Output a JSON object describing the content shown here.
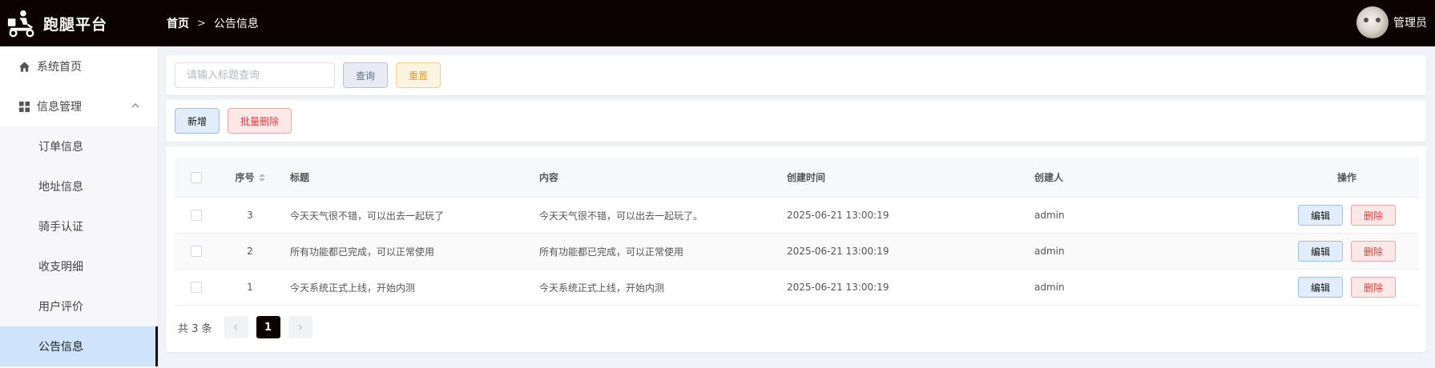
{
  "header": {
    "app_name": "跑腿平台",
    "breadcrumb": {
      "home": "首页",
      "separator": ">",
      "current": "公告信息"
    },
    "user": {
      "name": "管理员",
      "avatar": "cat-avatar"
    },
    "background": "#0c0204"
  },
  "sidebar": {
    "items": [
      {
        "label": "系统首页",
        "icon": "home-icon"
      },
      {
        "label": "信息管理",
        "icon": "grid-icon",
        "expanded": true
      }
    ],
    "submenu": [
      {
        "label": "订单信息"
      },
      {
        "label": "地址信息"
      },
      {
        "label": "骑手认证"
      },
      {
        "label": "收支明细"
      },
      {
        "label": "用户评价"
      },
      {
        "label": "公告信息",
        "active": true
      }
    ],
    "active_color": "#cfe4fb"
  },
  "search": {
    "placeholder": "请输入标题查询",
    "query_label": "查询",
    "reset_label": "重置"
  },
  "actions": {
    "add_label": "新增",
    "batch_delete_label": "批量删除"
  },
  "table": {
    "headers": {
      "index": "序号",
      "title": "标题",
      "content": "内容",
      "created_at": "创建时间",
      "creator": "创建人",
      "operations": "操作"
    },
    "rows": [
      {
        "index": "3",
        "title": "今天天气很不错，可以出去一起玩了",
        "content": "今天天气很不错，可以出去一起玩了。",
        "created_at": "2025-06-21 13:00:19",
        "creator": "admin",
        "edit": "编辑",
        "delete": "删除"
      },
      {
        "index": "2",
        "title": "所有功能都已完成，可以正常使用",
        "content": "所有功能都已完成，可以正常使用",
        "created_at": "2025-06-21 13:00:19",
        "creator": "admin",
        "edit": "编辑",
        "delete": "删除"
      },
      {
        "index": "1",
        "title": "今天系统正式上线，开始内测",
        "content": "今天系统正式上线，开始内测",
        "created_at": "2025-06-21 13:00:19",
        "creator": "admin",
        "edit": "编辑",
        "delete": "删除"
      }
    ]
  },
  "pagination": {
    "total_text": "共 3 条",
    "current_page": "1",
    "prev": "<",
    "next": ">"
  }
}
